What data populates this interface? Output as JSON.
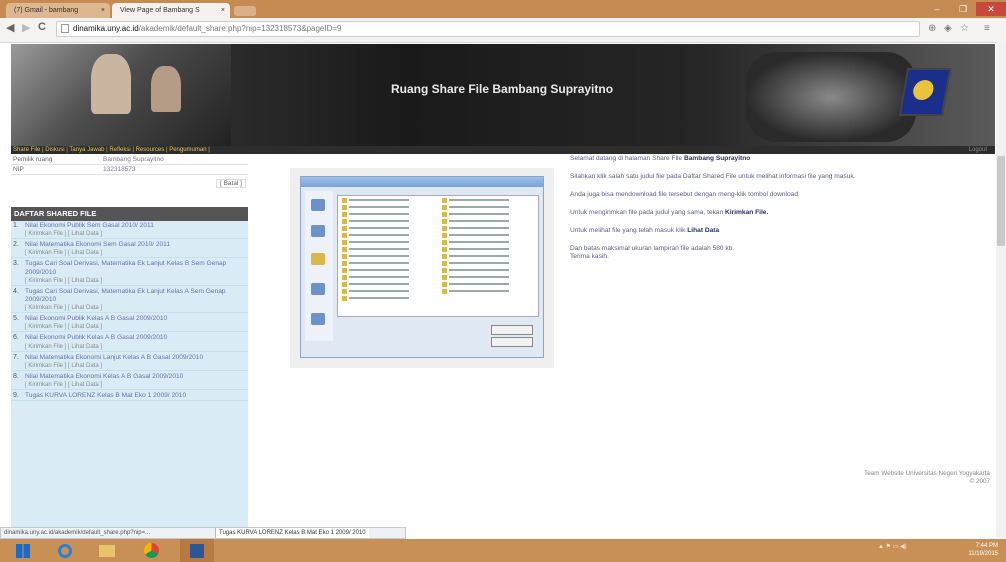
{
  "browser": {
    "tabs": [
      {
        "label": "(7) Gmail - bambang"
      },
      {
        "label": "View Page of Bambang S"
      }
    ],
    "tab_close_glyph": "×",
    "url": {
      "domain": "dinamika.uny.ac.id",
      "path": "/akademik/default_share.php?nip=132318573&pageID=9"
    },
    "window_buttons": {
      "minimize": "–",
      "maximize": "❐",
      "close": "✕"
    },
    "nav": {
      "back": "◀",
      "forward": "▶",
      "reload": "C"
    }
  },
  "site": {
    "title": "Ruang Share File Bambang Suprayitno",
    "menu": [
      "Share File",
      "Diskusi",
      "Tanya Jawab",
      "Refleksi",
      "Resources",
      "Pengumuman"
    ],
    "menu_right": "Logout"
  },
  "profile": {
    "rows": [
      {
        "key": "Pemilik ruang",
        "value": "Bambang Suprayitno"
      },
      {
        "key": "NIP",
        "value": "132318573"
      }
    ],
    "button": "[ Batal ]"
  },
  "shared_files": {
    "heading": "DAFTAR SHARED FILE",
    "items": [
      {
        "num": "1.",
        "title": "Nilai Ekonomi Publik Sem Gasal 2010/ 2011",
        "links": "[ Kirimkan File ] [ Lihat Data ]"
      },
      {
        "num": "2.",
        "title": "Nilai Matematika Ekonomi Sem Gasal 2010/ 2011",
        "links": "[ Kirimkan File ] [ Lihat Data ]"
      },
      {
        "num": "3.",
        "title": "Tugas Cari Soal Derivasi, Matematika Ek Lanjut Kelas B Sem Genap 2009/2010",
        "links": "[ Kirimkan File ] [ Lihat Data ]"
      },
      {
        "num": "4.",
        "title": "Tugas Cari Soal Derivasi, Matematika Ek Lanjut Kelas A Sem Genap 2009/2010",
        "links": "[ Kirimkan File ] [ Lihat Data ]"
      },
      {
        "num": "5.",
        "title": "Nilai Ekonomi Publik Kelas A B Gasal 2009/2010",
        "links": "[ Kirimkan File ] [ Lihat Data ]"
      },
      {
        "num": "6.",
        "title": "Nilai Ekonomi Publik Kelas A B Gasal 2009/2010",
        "links": "[ Kirimkan File ] [ Lihat Data ]"
      },
      {
        "num": "7.",
        "title": "Nilai Matematika Ekonomi Lanjut Kelas A B Gasal 2009/2010",
        "links": "[ Kirimkan File ] [ Lihat Data ]"
      },
      {
        "num": "8.",
        "title": "Nilai Matematika Ekonomi Kelas A B Gasal 2009/2010",
        "links": "[ Kirimkan File ] [ Lihat Data ]"
      },
      {
        "num": "9.",
        "title": "Tugas KURVA LORENZ Kelas B Mat Eko 1 2009/ 2010",
        "links": ""
      }
    ]
  },
  "intro": {
    "p1_prefix": "Selamat datang di halaman Share File ",
    "p1_name": "Bambang Suprayitno",
    "p2": "Silahkan klik salah satu judul file pada Daftar Shared File untuk melihat informasi file yang masuk.",
    "p3": "Anda juga bisa mendownload file tersebut dengan meng-klik tombol download.",
    "p4_prefix": "Untuk mengirimkan file pada judul yang sama, tekan ",
    "p4_bold": "Kirimkan File.",
    "p5_prefix": "Untuk melihat file yang telah masuk klik ",
    "p5_bold": "Lihat Data",
    "p6": "Dan batas maksimal ukuran lampiran file adalah 580 kb.",
    "p7": "Terima kasih."
  },
  "footer_note": {
    "line1": "Team Website Universitas Negeri Yogyakarta",
    "line2": "© 2007"
  },
  "status": {
    "url": "dinamika.uny.ac.id/akademik/default_share.php?nip=...",
    "tooltip": "Tugas KURVA LORENZ Kelas B Mat Eko 1 2009/ 2010"
  },
  "taskbar": {
    "tray": "▲ ⚑ ▭ ◀)",
    "time": "7:44 PM",
    "date": "11/19/2015"
  }
}
